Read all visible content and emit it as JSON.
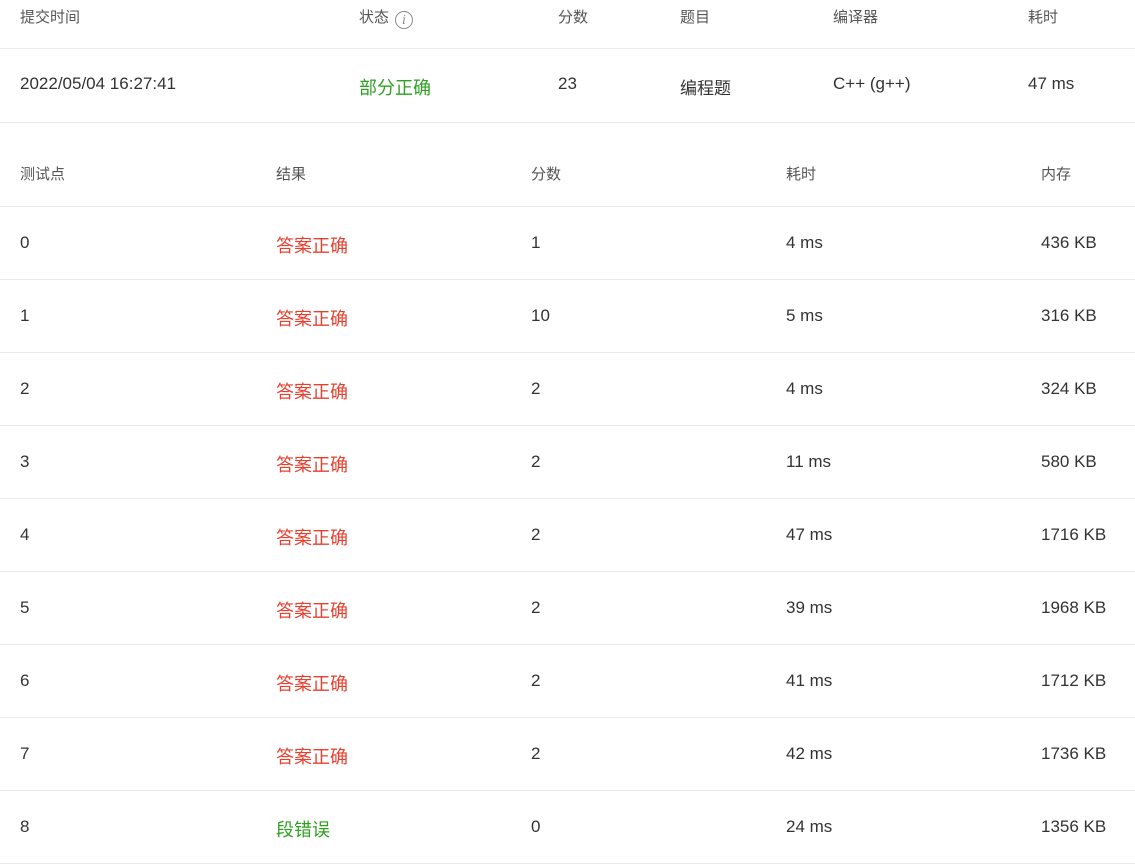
{
  "submission": {
    "headers": {
      "time": "提交时间",
      "status": "状态",
      "score": "分数",
      "problem": "题目",
      "compiler": "编译器",
      "elapsed": "耗时"
    },
    "row": {
      "time": "2022/05/04 16:27:41",
      "status": "部分正确",
      "score": "23",
      "problem": "编程题",
      "compiler": "C++ (g++)",
      "elapsed": "47 ms"
    },
    "status_info_icon": "info-circle-icon",
    "status_info_glyph": "i"
  },
  "cases": {
    "headers": {
      "id": "测试点",
      "result": "结果",
      "score": "分数",
      "time": "耗时",
      "memory": "内存"
    },
    "rows": [
      {
        "id": "0",
        "result": "答案正确",
        "score": "1",
        "time": "4 ms",
        "memory": "436 KB"
      },
      {
        "id": "1",
        "result": "答案正确",
        "score": "10",
        "time": "5 ms",
        "memory": "316 KB"
      },
      {
        "id": "2",
        "result": "答案正确",
        "score": "2",
        "time": "4 ms",
        "memory": "324 KB"
      },
      {
        "id": "3",
        "result": "答案正确",
        "score": "2",
        "time": "11 ms",
        "memory": "580 KB"
      },
      {
        "id": "4",
        "result": "答案正确",
        "score": "2",
        "time": "47 ms",
        "memory": "1716 KB"
      },
      {
        "id": "5",
        "result": "答案正确",
        "score": "2",
        "time": "39 ms",
        "memory": "1968 KB"
      },
      {
        "id": "6",
        "result": "答案正确",
        "score": "2",
        "time": "41 ms",
        "memory": "1712 KB"
      },
      {
        "id": "7",
        "result": "答案正确",
        "score": "2",
        "time": "42 ms",
        "memory": "1736 KB"
      },
      {
        "id": "8",
        "result": "段错误",
        "score": "0",
        "time": "24 ms",
        "memory": "1356 KB"
      }
    ]
  },
  "colors": {
    "accepted": "#e8402f",
    "partial": "#2ea121",
    "error": "#2ea121"
  }
}
